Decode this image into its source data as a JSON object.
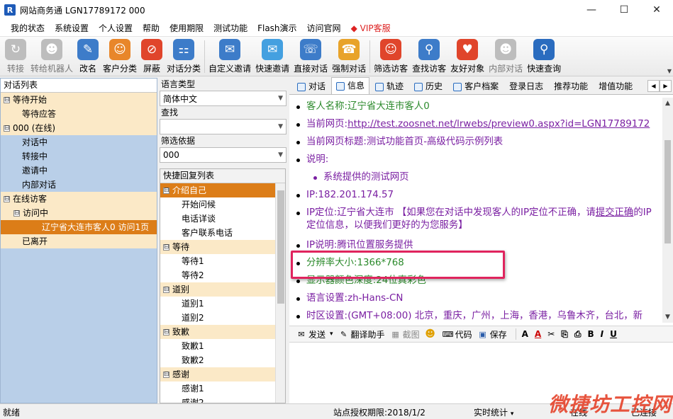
{
  "window": {
    "title": "网站商务通   LGN17789172 000",
    "app_icon_glyph": "R"
  },
  "window_buttons": {
    "minimize": "—",
    "maximize": "☐",
    "close": "✕"
  },
  "menu": [
    "我的状态",
    "系统设置",
    "个人设置",
    "帮助",
    "使用期限",
    "测试功能",
    "Flash演示",
    "访问官网",
    "VIP客服"
  ],
  "toolbar": [
    {
      "label": "转接",
      "icon": "transfer-icon",
      "glyph": "↻",
      "color": "#9a9a9a",
      "disabled": true
    },
    {
      "label": "转给机器人",
      "icon": "robot-icon",
      "glyph": "☻",
      "color": "#9a9a9a",
      "disabled": true
    },
    {
      "label": "改名",
      "icon": "rename-card-icon",
      "glyph": "✎",
      "color": "#3d7cc9",
      "disabled": false
    },
    {
      "label": "客户分类",
      "icon": "customer-group-icon",
      "glyph": "☺",
      "color": "#e8862a",
      "disabled": false
    },
    {
      "label": "屏蔽",
      "icon": "block-icon",
      "glyph": "⊘",
      "color": "#e0452b",
      "disabled": false
    },
    {
      "label": "对话分类",
      "icon": "dialog-tree-icon",
      "glyph": "⚏",
      "color": "#3d7cc9",
      "disabled": false
    },
    {
      "label": "自定义邀请",
      "icon": "custom-invite-icon",
      "glyph": "✉",
      "color": "#3d7cc9",
      "disabled": false
    },
    {
      "label": "快速邀请",
      "icon": "quick-invite-icon",
      "glyph": "✉",
      "color": "#44a0e0",
      "disabled": false
    },
    {
      "label": "直接对话",
      "icon": "direct-chat-icon",
      "glyph": "☏",
      "color": "#3d7cc9",
      "disabled": false
    },
    {
      "label": "强制对话",
      "icon": "force-chat-icon",
      "glyph": "☎",
      "color": "#e8a32a",
      "disabled": false
    },
    {
      "label": "筛选访客",
      "icon": "filter-visitor-icon",
      "glyph": "☺",
      "color": "#e0452b",
      "disabled": false
    },
    {
      "label": "查找访客",
      "icon": "find-visitor-icon",
      "glyph": "⚲",
      "color": "#3d7cc9",
      "disabled": false
    },
    {
      "label": "友好对象",
      "icon": "friendly-visitor-icon",
      "glyph": "♥",
      "color": "#e0452b",
      "disabled": false
    },
    {
      "label": "内部对话",
      "icon": "internal-chat-icon",
      "glyph": "☻",
      "color": "#9a9a9a",
      "disabled": true
    },
    {
      "label": "快速查询",
      "icon": "magnifier-icon",
      "glyph": "⚲",
      "color": "#2a6cbf",
      "disabled": false
    }
  ],
  "left_panel": {
    "header": "对话列表",
    "tree": [
      {
        "label": "等待开始",
        "level": 0,
        "toggle": "⊟",
        "type": "group",
        "selected": false
      },
      {
        "label": "等待应答",
        "level": 1,
        "toggle": "",
        "type": "sub",
        "selected": false
      },
      {
        "label": "000 (在线)",
        "level": 0,
        "toggle": "⊟",
        "type": "group",
        "selected": false
      },
      {
        "label": "对话中",
        "level": 1,
        "toggle": "",
        "type": "plain",
        "selected": false
      },
      {
        "label": "转接中",
        "level": 1,
        "toggle": "",
        "type": "plain",
        "selected": false
      },
      {
        "label": "邀请中",
        "level": 1,
        "toggle": "",
        "type": "plain",
        "selected": false
      },
      {
        "label": "内部对话",
        "level": 1,
        "toggle": "",
        "type": "plain",
        "selected": false
      },
      {
        "label": "在线访客",
        "level": 0,
        "toggle": "⊟",
        "type": "group",
        "selected": false
      },
      {
        "label": "访问中",
        "level": 1,
        "toggle": "⊟",
        "type": "sub",
        "selected": false
      },
      {
        "label": "辽宁省大连市客人0 访问1页",
        "level": 2,
        "toggle": "",
        "type": "sub",
        "selected": true
      },
      {
        "label": "已离开",
        "level": 1,
        "toggle": "",
        "type": "sub",
        "selected": false
      }
    ]
  },
  "mid_panel": {
    "language_label": "语言类型",
    "language_value": "简体中文",
    "search_label": "查找",
    "search_value": "",
    "filter_label": "筛选依据",
    "filter_value": "000",
    "quick_reply_title": "快捷回复列表",
    "quick_replies": [
      {
        "label": "介绍自己",
        "type": "cat",
        "selected": true
      },
      {
        "label": "开始问候",
        "type": "leaf"
      },
      {
        "label": "电话详谈",
        "type": "leaf"
      },
      {
        "label": "客户联系电话",
        "type": "leaf"
      },
      {
        "label": "等待",
        "type": "cat",
        "selected": false
      },
      {
        "label": "等待1",
        "type": "leaf"
      },
      {
        "label": "等待2",
        "type": "leaf"
      },
      {
        "label": "道别",
        "type": "cat",
        "selected": false
      },
      {
        "label": "道别1",
        "type": "leaf"
      },
      {
        "label": "道别2",
        "type": "leaf"
      },
      {
        "label": "致歉",
        "type": "cat",
        "selected": false
      },
      {
        "label": "致歉1",
        "type": "leaf"
      },
      {
        "label": "致歉2",
        "type": "leaf"
      },
      {
        "label": "感谢",
        "type": "cat",
        "selected": false
      },
      {
        "label": "感谢1",
        "type": "leaf"
      },
      {
        "label": "感谢2",
        "type": "leaf"
      }
    ]
  },
  "tabs": [
    {
      "label": "对话",
      "active": false,
      "icon": true
    },
    {
      "label": "信息",
      "active": true,
      "icon": true
    },
    {
      "label": "轨迹",
      "active": false,
      "icon": true
    },
    {
      "label": "历史",
      "active": false,
      "icon": true
    },
    {
      "label": "客户档案",
      "active": false,
      "icon": true
    },
    {
      "label": "登录日志",
      "active": false,
      "icon": false
    },
    {
      "label": "推荐功能",
      "active": false,
      "icon": false
    },
    {
      "label": "增值功能",
      "active": false,
      "icon": false
    }
  ],
  "info": {
    "visitor_name": "客人名称:辽宁省大连市客人0",
    "current_page_label": "当前网页:",
    "current_page_url": "http://test.zoosnet.net/lrwebs/preview0.aspx?id=LGN17789172",
    "page_title": "当前网页标题:测试功能首页-高级代码示例列表",
    "note_label": "说明:",
    "note_item": "系统提供的测试网页",
    "ip": "IP:182.201.174.57",
    "ip_location_prefix": "IP定位:辽宁省大连市   【如果您在对话中发现客人的IP定位不正确，请",
    "ip_location_link": "提交正确",
    "ip_location_suffix": "的IP定位信息，以便我们更好的为您服务】",
    "ip_note": "IP说明:腾讯位置服务提供",
    "resolution": "分辨率大小:1366*768",
    "color_depth": "显示器颜色深度:24位真彩色",
    "language": "语言设置:zh-Hans-CN",
    "timezone": "时区设置:(GMT+08:00) 北京，重庆，广州，上海，香港，乌鲁木齐，台北，新"
  },
  "chat_toolbar": {
    "send": "发送",
    "send_arrow": "▾",
    "translate": "翻译助手",
    "screenshot": "截图",
    "code": "代码",
    "save": "保存",
    "format": [
      "A",
      "A",
      "✂",
      "⎘",
      "⎙",
      "B",
      "I",
      "U"
    ]
  },
  "status": {
    "left": "就绪",
    "license": "站点授权期限:2018/1/2",
    "stats": "实时统计",
    "stats_arrow": "▾",
    "online": "在线",
    "connected": "已连接"
  },
  "watermark": "微捷坊工控网",
  "colors": {
    "selected": "#dc7d18",
    "group_bg": "#fbe9c7",
    "tree_bg": "#b9cfe8",
    "info_green": "#2c8a2c",
    "info_purple": "#7a1fa2",
    "highlight": "#e0245e"
  }
}
